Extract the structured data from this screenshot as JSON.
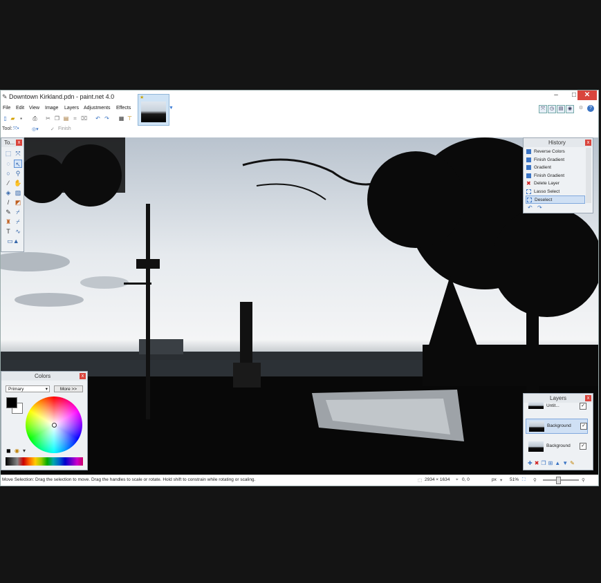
{
  "window": {
    "title": "Downtown Kirkland.pdn - paint.net 4.0",
    "controls": {
      "minimize": "–",
      "maximize": "□",
      "close": "✕"
    }
  },
  "menu": [
    "File",
    "Edit",
    "View",
    "Image",
    "Layers",
    "Adjustments",
    "Effects"
  ],
  "toolbar2": {
    "tool_label": "Tool:",
    "finish_label": "Finish"
  },
  "panels": {
    "tools": {
      "title": "To..."
    },
    "history": {
      "title": "History",
      "items": [
        "Reverse Colors",
        "Finish Gradient",
        "Gradient",
        "Finish Gradient",
        "Delete Layer",
        "Lasso Select",
        "Deselect"
      ],
      "selected_index": 6
    },
    "colors": {
      "title": "Colors",
      "mode": "Primary",
      "more_button": "More >>"
    },
    "layers": {
      "title": "Layers",
      "items": [
        "Untit...",
        "Background",
        "Background"
      ],
      "selected_index": 1
    }
  },
  "status": {
    "hint": "Move Selection: Drag the selection to move. Drag the handles to scale or rotate. Hold shift to constrain while rotating or scaling.",
    "image_size": "2934 × 1634",
    "cursor_pos": "0, 0",
    "units": "px",
    "zoom": "51%"
  },
  "colors": {
    "accent": "#3a74c4",
    "close_red": "#d9453d",
    "selection": "#cfe0f4"
  }
}
